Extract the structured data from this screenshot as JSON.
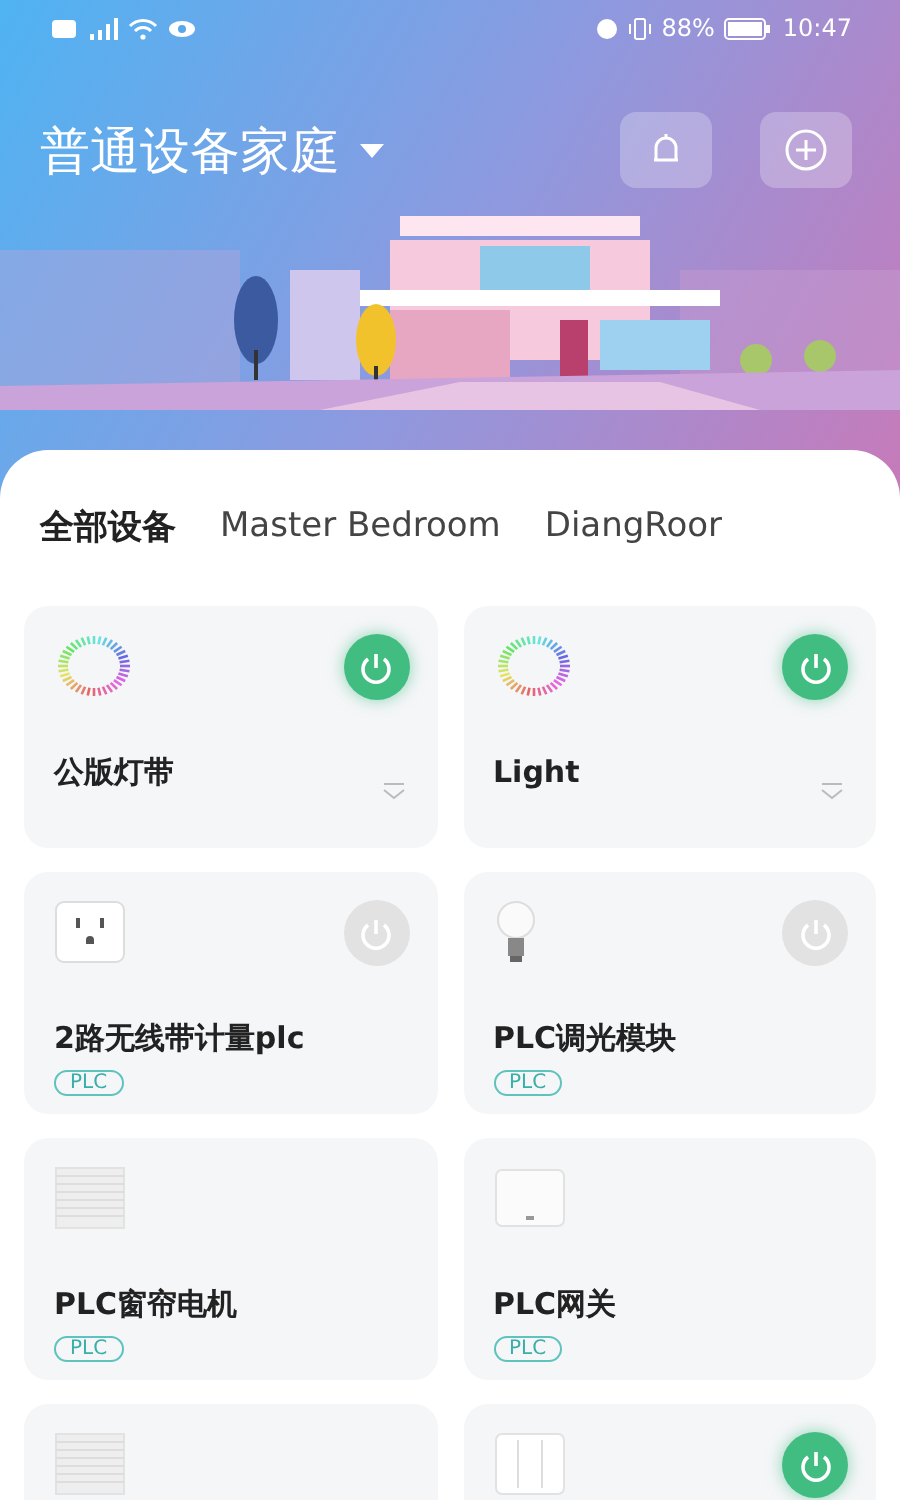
{
  "status_bar": {
    "battery_text": "88%",
    "time": "10:47"
  },
  "header": {
    "home_title": "普通设备家庭"
  },
  "tabs": [
    {
      "label": "全部设备",
      "selected": true
    },
    {
      "label": "Master Bedroom",
      "selected": false
    },
    {
      "label": "DiangRoor",
      "selected": false
    }
  ],
  "devices": [
    {
      "kind": "ring",
      "name": "公版灯带",
      "power_on": true,
      "expandable": true
    },
    {
      "kind": "ring",
      "name": "Light",
      "power_on": true,
      "expandable": true
    },
    {
      "kind": "socket",
      "name": "2路无线带计量plc",
      "power_on": false,
      "tag": "PLC"
    },
    {
      "kind": "bulb",
      "name": "PLC调光模块",
      "power_on": false,
      "tag": "PLC"
    },
    {
      "kind": "curtain",
      "name": "PLC窗帘电机",
      "tag": "PLC"
    },
    {
      "kind": "gateway",
      "name": "PLC网关",
      "tag": "PLC"
    },
    {
      "kind": "curtain"
    },
    {
      "kind": "panel",
      "power_on": true
    }
  ]
}
